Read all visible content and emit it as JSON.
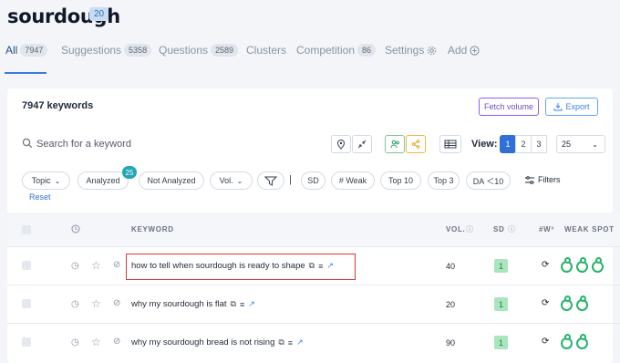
{
  "header": {
    "title": "sourdough",
    "title_badge": "20"
  },
  "tabs": [
    {
      "label": "All",
      "count": "7947"
    },
    {
      "label": "Suggestions",
      "count": "5358"
    },
    {
      "label": "Questions",
      "count": "2589"
    },
    {
      "label": "Clusters"
    },
    {
      "label": "Competition",
      "count": "86"
    },
    {
      "label": "Settings",
      "icon": "gear-icon"
    },
    {
      "label": "Add",
      "icon": "plus-circle-icon"
    }
  ],
  "panel": {
    "keyword_count": "7947 keywords",
    "fetch_label": "Fetch volume",
    "export_label": "Export",
    "search_placeholder": "Search for a keyword",
    "view_label": "View:",
    "pages": [
      "1",
      "2",
      "3"
    ],
    "per_page": "25"
  },
  "filters": {
    "topic": "Topic",
    "analyzed": "Analyzed",
    "analyzed_count": "25",
    "not_analyzed": "Not Analyzed",
    "vol": "Vol.",
    "separator": "|",
    "sd": "SD",
    "weak": "# Weak",
    "top10": "Top 10",
    "top3": "Top 3",
    "da": "DA ＜10",
    "filters": "Filters",
    "reset": "Reset"
  },
  "table": {
    "headers": {
      "keyword": "KEYWORD",
      "vol": "VOL.",
      "sd": "SD",
      "w3": "#W³",
      "weak_spots": "WEAK SPOT"
    },
    "rows": [
      {
        "keyword": "how to tell when sourdough is ready to shape",
        "vol": "40",
        "sd": "1",
        "weak_spots": 3
      },
      {
        "keyword": "why my sourdough is flat",
        "vol": "20",
        "sd": "1",
        "weak_spots": 2
      },
      {
        "keyword": "why my sourdough bread is not rising",
        "vol": "90",
        "sd": "1",
        "weak_spots": 2
      }
    ]
  },
  "colors": {
    "accent": "#2f6fd6",
    "fetch_border": "#8b5cf6",
    "highlight": "#d93636",
    "weak_spot": "#25b36a",
    "sd_badge": "#a9e5bd"
  }
}
